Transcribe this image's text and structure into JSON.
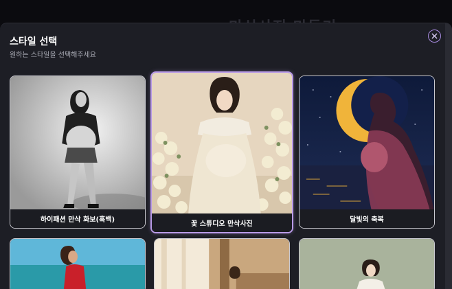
{
  "backdrop": {
    "title": "만삭사진 만들기"
  },
  "modal": {
    "title": "스타일 선택",
    "subtitle": "원하는 스타일을 선택해주세요",
    "close_icon": "close-icon",
    "accent_color": "#b99ae8"
  },
  "styles": [
    {
      "label": "하이패션 만삭 화보(흑백)",
      "selected": false
    },
    {
      "label": "꽃 스튜디오 만삭사진",
      "selected": true
    },
    {
      "label": "달빛의 축복",
      "selected": false
    },
    {
      "label": "",
      "selected": false
    },
    {
      "label": "",
      "selected": false
    },
    {
      "label": "",
      "selected": false
    }
  ]
}
